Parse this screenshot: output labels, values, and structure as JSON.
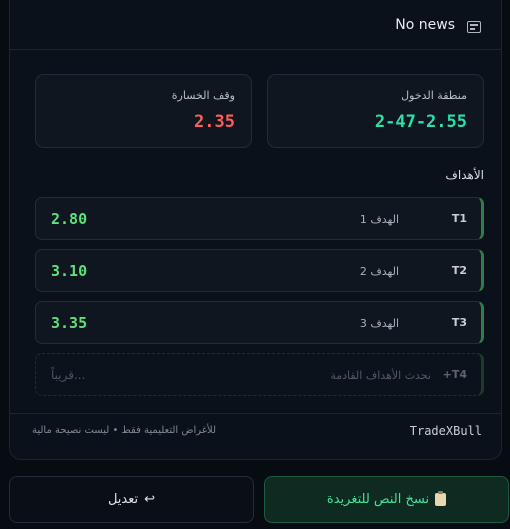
{
  "header": {
    "news_text": "No news",
    "icon": "newspaper-icon"
  },
  "entry": {
    "label": "منطقة الدخول",
    "value": "2-47-2.55"
  },
  "stop": {
    "label": "وقف الخسارة",
    "value": "2.35"
  },
  "targets_title": "الأهداف",
  "targets": [
    {
      "code": "T1",
      "name": "الهدف 1",
      "value": "2.80"
    },
    {
      "code": "T2",
      "name": "الهدف 2",
      "value": "3.10"
    },
    {
      "code": "T3",
      "name": "الهدف 3",
      "value": "3.35"
    },
    {
      "code": "+T4",
      "name": "نحدث الأهداف القادمة",
      "value": "قريباً..."
    }
  ],
  "footer": {
    "disclaimer": "للأغراض التعليمية فقط • ليست نصيحة مالية",
    "brand": "TradeXBull"
  },
  "buttons": {
    "edit": {
      "label": "تعديل",
      "glyph": "↩"
    },
    "copy": {
      "label": "نسخ النص للتغريدة"
    }
  },
  "colors": {
    "entry": "#2ee0a6",
    "stop": "#ff5c5c",
    "target": "#5ee07a",
    "accent_green": "#44e29a"
  }
}
